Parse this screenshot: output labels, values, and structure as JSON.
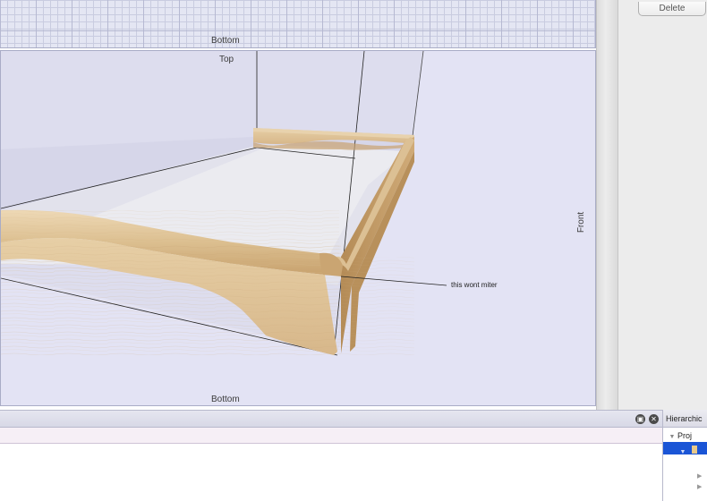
{
  "top_view": {
    "label": "Bottom"
  },
  "main_view": {
    "top_label": "Top",
    "bottom_label": "Bottom",
    "front_label": "Front",
    "annotation": "this wont miter"
  },
  "right_panel": {
    "delete_label": "Delete"
  },
  "hierarchy": {
    "title": "Hierarchic",
    "root_label": "Proj",
    "expand_icons": [
      "chevron-right-icon",
      "chevron-right-icon"
    ]
  },
  "bottom_bar": {
    "icons": [
      "restore-panel-icon",
      "close-panel-icon"
    ]
  },
  "colors": {
    "viewport_bg": "#e3e3f4",
    "wood_light": "#e6cfa9",
    "wood_dark": "#b88f5a",
    "selection": "#1a55d6"
  }
}
